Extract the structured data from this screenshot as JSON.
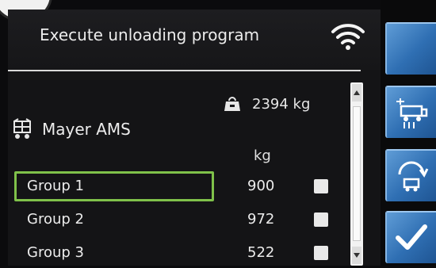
{
  "header": {
    "title": "Execute unloading program",
    "wifi_icon": "wifi-icon"
  },
  "summary": {
    "total_weight": "2394 kg",
    "weight_icon": "weight-icon"
  },
  "machine": {
    "name": "Mayer AMS",
    "icon": "feed-mixer-icon"
  },
  "table": {
    "unit_header": "kg",
    "groups": [
      {
        "label": "Group 1",
        "value": "900",
        "selected": true,
        "checked": false
      },
      {
        "label": "Group 2",
        "value": "972",
        "selected": false,
        "checked": false
      },
      {
        "label": "Group 3",
        "value": "522",
        "selected": false,
        "checked": false
      }
    ]
  },
  "sidebar": {
    "buttons": [
      {
        "icon": "blank-button-icon"
      },
      {
        "icon": "unloading-vehicle-icon"
      },
      {
        "icon": "refill-icon"
      },
      {
        "icon": "checkmark-icon"
      }
    ]
  },
  "colors": {
    "accent_blue": "#2f6fb3",
    "selection_green": "#7fc14a",
    "background": "#141416"
  }
}
